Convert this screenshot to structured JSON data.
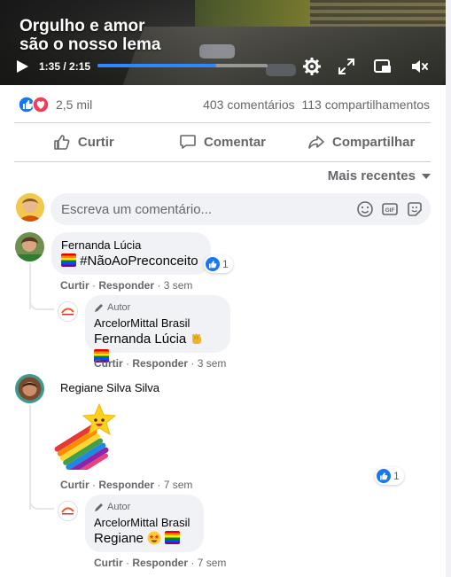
{
  "video": {
    "overlay_title": "Orgulho e amor\nsão o nosso lema",
    "time": "1:35 / 2:15",
    "progress": 0.7,
    "accent": "#2d88ff"
  },
  "stats": {
    "reactions": "2,5 mil",
    "comments": "403 comentários",
    "shares": "113 compartilhamentos"
  },
  "actions": {
    "like": "Curtir",
    "comment": "Comentar",
    "share": "Compartilhar"
  },
  "sort": {
    "label": "Mais recentes"
  },
  "composer": {
    "placeholder": "Escreva um comentário..."
  },
  "comments": [
    {
      "name": "Fernanda Lúcia",
      "text": "#NãoAoPreconceito",
      "reactions": "1",
      "like": "Curtir",
      "reply": "Responder",
      "time": "3 sem",
      "reply_item": {
        "badge": "Autor",
        "name": "ArcelorMittal Brasil",
        "text": "Fernanda Lúcia",
        "like": "Curtir",
        "reply": "Responder",
        "time": "3 sem"
      }
    },
    {
      "name": "Regiane Silva Silva",
      "reactions": "1",
      "like": "Curtir",
      "reply": "Responder",
      "time": "7 sem",
      "reply_item": {
        "badge": "Autor",
        "name": "ArcelorMittal Brasil",
        "text": "Regiane",
        "like": "Curtir",
        "reply": "Responder",
        "time": "7 sem"
      }
    }
  ],
  "colors": {
    "like_blue": "#1877f2",
    "love_red": "#f33e58",
    "text_secondary": "#65676b",
    "bubble_bg": "#f0f2f5"
  }
}
